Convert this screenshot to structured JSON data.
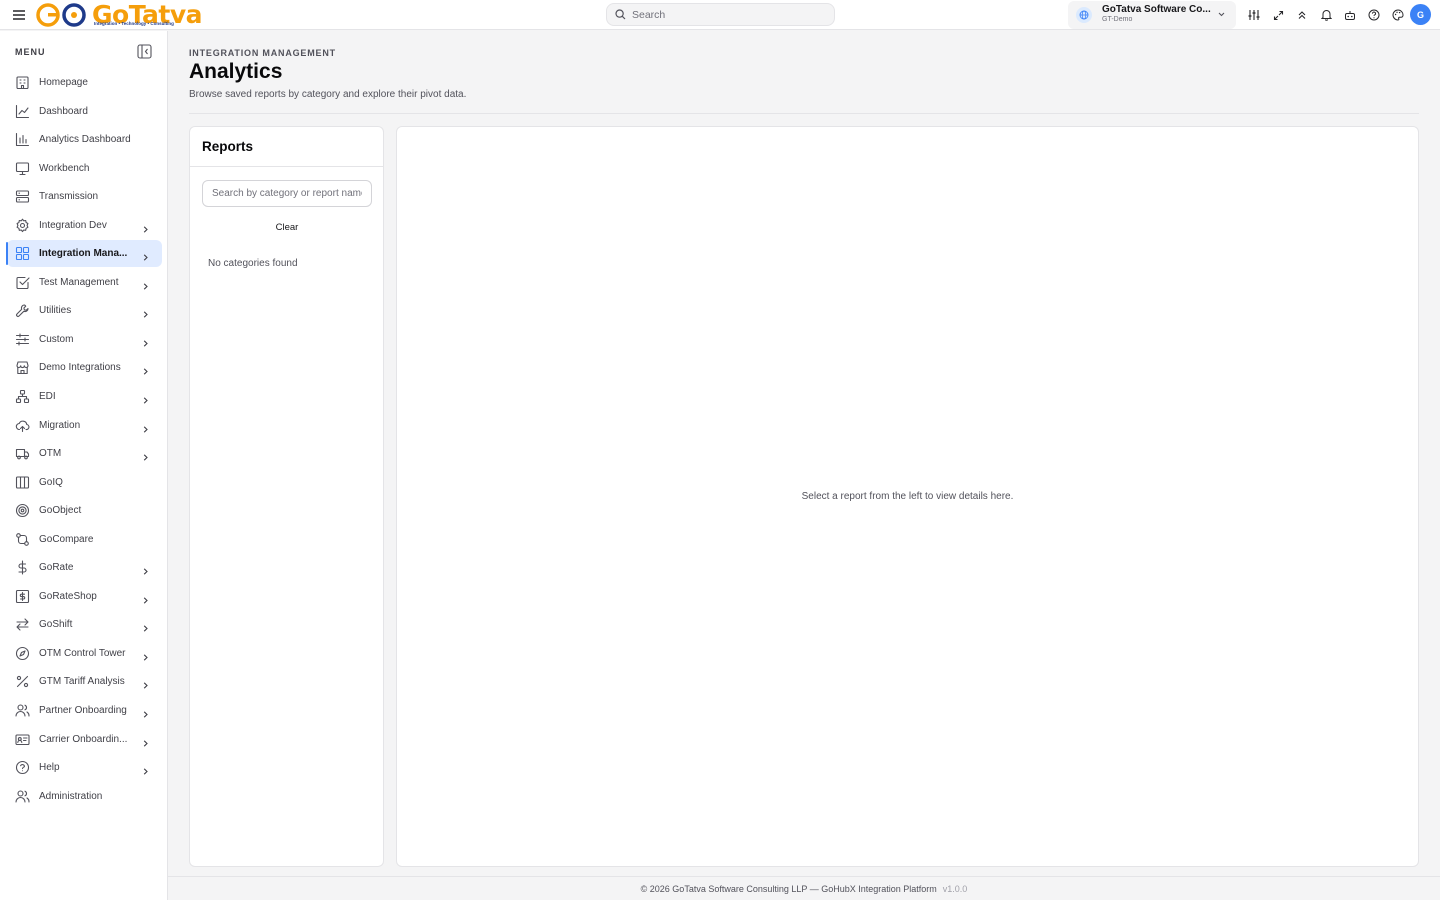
{
  "header": {
    "logo_text": "GoTatva",
    "logo_tagline": "Integration • Technology • Consulting",
    "search_placeholder": "Search",
    "org_name": "GoTatva Software Co...",
    "org_env": "GT-Demo",
    "avatar_initial": "G"
  },
  "sidebar": {
    "menu_label": "MENU",
    "items": [
      {
        "label": "Homepage",
        "icon": "building-icon",
        "chevron": false,
        "active": false
      },
      {
        "label": "Dashboard",
        "icon": "line-chart-icon",
        "chevron": false,
        "active": false
      },
      {
        "label": "Analytics Dashboard",
        "icon": "bar-chart-icon",
        "chevron": false,
        "active": false
      },
      {
        "label": "Workbench",
        "icon": "monitor-icon",
        "chevron": false,
        "active": false
      },
      {
        "label": "Transmission",
        "icon": "server-icon",
        "chevron": false,
        "active": false
      },
      {
        "label": "Integration Dev",
        "icon": "gear-icon",
        "chevron": true,
        "active": false
      },
      {
        "label": "Integration Mana...",
        "icon": "grid-icon",
        "chevron": true,
        "active": true
      },
      {
        "label": "Test Management",
        "icon": "checkbox-icon",
        "chevron": true,
        "active": false
      },
      {
        "label": "Utilities",
        "icon": "wrench-icon",
        "chevron": true,
        "active": false
      },
      {
        "label": "Custom",
        "icon": "sliders-icon",
        "chevron": true,
        "active": false
      },
      {
        "label": "Demo Integrations",
        "icon": "store-icon",
        "chevron": true,
        "active": false
      },
      {
        "label": "EDI",
        "icon": "network-icon",
        "chevron": true,
        "active": false
      },
      {
        "label": "Migration",
        "icon": "cloud-upload-icon",
        "chevron": true,
        "active": false
      },
      {
        "label": "OTM",
        "icon": "truck-icon",
        "chevron": true,
        "active": false
      },
      {
        "label": "GoIQ",
        "icon": "columns-icon",
        "chevron": false,
        "active": false
      },
      {
        "label": "GoObject",
        "icon": "target-icon",
        "chevron": false,
        "active": false
      },
      {
        "label": "GoCompare",
        "icon": "compare-icon",
        "chevron": false,
        "active": false
      },
      {
        "label": "GoRate",
        "icon": "dollar-icon",
        "chevron": true,
        "active": false
      },
      {
        "label": "GoRateShop",
        "icon": "dollar-square-icon",
        "chevron": true,
        "active": false
      },
      {
        "label": "GoShift",
        "icon": "swap-icon",
        "chevron": true,
        "active": false
      },
      {
        "label": "OTM Control Tower",
        "icon": "compass-icon",
        "chevron": true,
        "active": false
      },
      {
        "label": "GTM Tariff Analysis",
        "icon": "percent-icon",
        "chevron": true,
        "active": false
      },
      {
        "label": "Partner Onboarding",
        "icon": "users-icon",
        "chevron": true,
        "active": false
      },
      {
        "label": "Carrier Onboardin...",
        "icon": "id-card-icon",
        "chevron": true,
        "active": false
      },
      {
        "label": "Help",
        "icon": "help-circle-icon",
        "chevron": true,
        "active": false
      },
      {
        "label": "Administration",
        "icon": "users-icon",
        "chevron": false,
        "active": false
      }
    ]
  },
  "main": {
    "breadcrumb": "INTEGRATION MANAGEMENT",
    "title": "Analytics",
    "subtitle": "Browse saved reports by category and explore their pivot data.",
    "reports": {
      "title": "Reports",
      "search_placeholder": "Search by category or report name",
      "clear_label": "Clear",
      "empty_text": "No categories found"
    },
    "detail": {
      "empty_text": "Select a report from the left to view details here."
    }
  },
  "footer": {
    "text": "© 2026 GoTatva Software Consulting LLP — GoHubX Integration Platform",
    "version": "v1.0.0"
  },
  "colors": {
    "accent": "#3b82f6",
    "active_bg": "#e0ebff",
    "logo": "#f59e0b"
  }
}
